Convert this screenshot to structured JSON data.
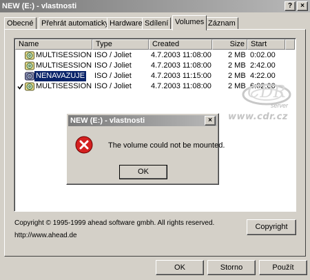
{
  "window": {
    "title": "NEW (E:) - vlastnosti",
    "help_label": "?",
    "close_label": "×"
  },
  "tabs": [
    {
      "label": "Obecné"
    },
    {
      "label": "Přehrát automaticky"
    },
    {
      "label": "Hardware"
    },
    {
      "label": "Sdílení"
    },
    {
      "label": "Volumes",
      "active": true
    },
    {
      "label": "Záznam"
    }
  ],
  "list": {
    "columns": [
      "Name",
      "Type",
      "Created",
      "Size",
      "Start"
    ],
    "rows": [
      {
        "name": "MULTISESSION",
        "type": "ISO / Joliet",
        "created": "4.7.2003 11:08:00",
        "size": "2 MB",
        "start": "0:02.00",
        "checked": false,
        "selected": false
      },
      {
        "name": "MULTISESSION",
        "type": "ISO / Joliet",
        "created": "4.7.2003 11:08:00",
        "size": "2 MB",
        "start": "2:42.00",
        "checked": false,
        "selected": false
      },
      {
        "name": "NENAVAZUJE",
        "type": "ISO / Joliet",
        "created": "4.7.2003 11:15:00",
        "size": "2 MB",
        "start": "4:22.00",
        "checked": false,
        "selected": true
      },
      {
        "name": "MULTISESSION",
        "type": "ISO / Joliet",
        "created": "4.7.2003 11:08:00",
        "size": "2 MB",
        "start": "6:02.00",
        "checked": true,
        "selected": false
      }
    ]
  },
  "watermark": {
    "logo_text": "CDR",
    "server_text": "server",
    "url_text": "www.cdr.cz"
  },
  "dialog": {
    "title": "NEW (E:) - vlastnosti",
    "close_label": "×",
    "message": "The volume could not be mounted.",
    "ok_label": "OK",
    "icon": "error-icon"
  },
  "footer": {
    "copyright": "Copyright © 1995-1999 ahead software gmbh. All rights reserved.",
    "url": "http://www.ahead.de",
    "copyright_button": "Copyright"
  },
  "buttons": {
    "ok": "OK",
    "cancel": "Storno",
    "apply": "Použít"
  },
  "colors": {
    "selection": "#0a246a",
    "face": "#d4d0c8",
    "error_red": "#d42020"
  }
}
